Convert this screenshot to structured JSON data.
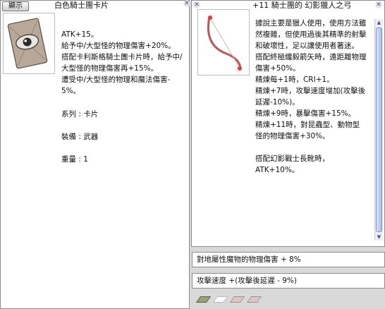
{
  "card_window": {
    "show_button_label": "顯示",
    "title": "白色騎士團卡片",
    "image_icon": "eye-card-icon",
    "description": "ATK+15。\n給予中/大型怪的物理傷害+20%。\n搭配卡利斯格騎士團卡片時，給予中/大型怪的物理傷害再+15%。\n遭受中/大型怪的物理和魔法傷害- 5%。",
    "stats": [
      {
        "label": "系列",
        "value": "卡片"
      },
      {
        "label": "裝備",
        "value": "武器"
      },
      {
        "label": "重量",
        "value": "1"
      }
    ]
  },
  "bow_window": {
    "title": "+11 騎士團的 幻影獵人之弓",
    "image_icon": "bow-icon",
    "description": "據說主要是獵人使用，使用方法雖然複雜，但使用過後其精準的射擊和破壞性，足以讓使用者著迷。\n搭配終極纖毅箭矢時，遠距離物理傷害+50%。\n精煉每+1時，CRI+1。\n精煉+7時，攻擊速度增加(攻擊後延遲-10%)。\n精煉+9時，暴擊傷害+15%。\n精煉+11時，對昆蟲型、動物型怪的物理傷害+30%。\n\n搭配幻影戰士長靴時，ATK+10%。"
  },
  "random_options": [
    "對地屬性魔物的物理傷害 + 8%",
    "攻擊速度 +(攻擊後延遲 - 9%)"
  ],
  "card_slots": [
    {
      "state": "weapon-card"
    },
    {
      "state": "empty"
    },
    {
      "state": "card"
    },
    {
      "state": "card"
    }
  ],
  "colors": {
    "scrollbar_thumb": "#a9bbe6",
    "scrollbar_border": "#7e93c9",
    "window_border": "#8c8c8c",
    "background": "#d9d9d9"
  }
}
